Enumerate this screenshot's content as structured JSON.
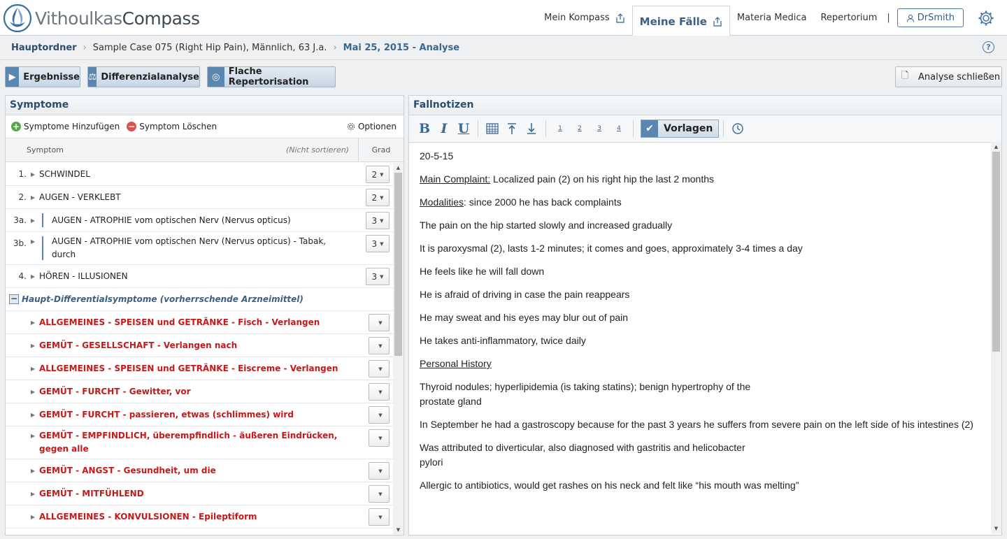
{
  "app": {
    "logo_part1": "Vithoulkas",
    "logo_part2": "Compass"
  },
  "nav": {
    "items": [
      "Mein Kompass",
      "Meine Fälle",
      "Materia Medica",
      "Repertorium"
    ],
    "separator": "|",
    "user": "DrSmith"
  },
  "breadcrumb": {
    "items": [
      "Hauptordner",
      "Sample Case 075 (Right Hip Pain), Männlich, 63 J.a.",
      "Mai 25, 2015 - Analyse"
    ],
    "help": "?"
  },
  "toolbar": {
    "results": "Ergebnisse",
    "differential": "Differenzialanalyse",
    "flat": "Flache Repertorisation",
    "close": "Analyse schließen"
  },
  "symptoms": {
    "title": "Symptome",
    "add": "Symptome Hinzufügen",
    "delete": "Symptom Löschen",
    "options": "Optionen",
    "col_symptom": "Symptom",
    "col_sort": "(Nicht sortieren)",
    "col_grade": "Grad",
    "rows": [
      {
        "num": "1.",
        "text": "SCHWINDEL",
        "grade": "2"
      },
      {
        "num": "2.",
        "text": "AUGEN - VERKLEBT",
        "grade": "2"
      },
      {
        "num": "3a.",
        "text": "AUGEN - ATROPHIE vom optischen Nerv (Nervus opticus)",
        "grade": "3"
      },
      {
        "num": "3b.",
        "text": "AUGEN - ATROPHIE vom optischen Nerv (Nervus opticus) - Tabak, durch",
        "grade": "3"
      },
      {
        "num": "4.",
        "text": "HÖREN - ILLUSIONEN",
        "grade": "3"
      }
    ],
    "group_title": "Haupt-Differentialsymptome (vorherrschende Arzneimittel)",
    "group_rows": [
      "ALLGEMEINES - SPEISEN und GETRÄNKE - Fisch - Verlangen",
      "GEMÜT - GESELLSCHAFT - Verlangen nach",
      "ALLGEMEINES - SPEISEN und GETRÄNKE - Eiscreme - Verlangen",
      "GEMÜT - FURCHT - Gewitter, vor",
      "GEMÜT - FURCHT - passieren, etwas (schlimmes) wird",
      "GEMÜT - EMPFINDLICH, überempfindlich - äußeren Eindrücken, gegen alle",
      "GEMÜT - ANGST - Gesundheit, um die",
      "GEMÜT - MITFÜHLEND",
      "ALLGEMEINES - KONVULSIONEN - Epileptiform"
    ]
  },
  "notes": {
    "title": "Fallnotizen",
    "templates": "Vorlagen",
    "date": "20-5-15",
    "main_label": "Main Complaint:",
    "main_text": " Localized pain (2) on his right hip the last 2 months",
    "mod_label": "Modalities",
    "mod_text": ": since 2000 he has back complaints",
    "lines": [
      "The pain on the hip started slowly and increased gradually",
      "It is paroxysmal (2), lasts 1-2 minutes; it comes and goes, approximately 3-4 times a day",
      "He feels like he will fall down",
      "He is afraid of driving in case the pain reappears",
      "He may sweat and his eyes may blur out of pain",
      "He takes anti-inflammatory, twice daily"
    ],
    "personal_history": "Personal History",
    "lines2": [
      "Thyroid nodules; hyperlipidemia (is taking statins); benign hypertrophy of the\nprostate gland",
      "In September he had a gastroscopy because for the past 3 years he suffers from severe pain on the left side of his intestines (2)",
      "Was attributed to diverticular, also diagnosed with gastritis and helicobacter\npylori",
      "Allergic to antibiotics, would get rashes on his neck and felt like “his mouth was melting”"
    ]
  }
}
